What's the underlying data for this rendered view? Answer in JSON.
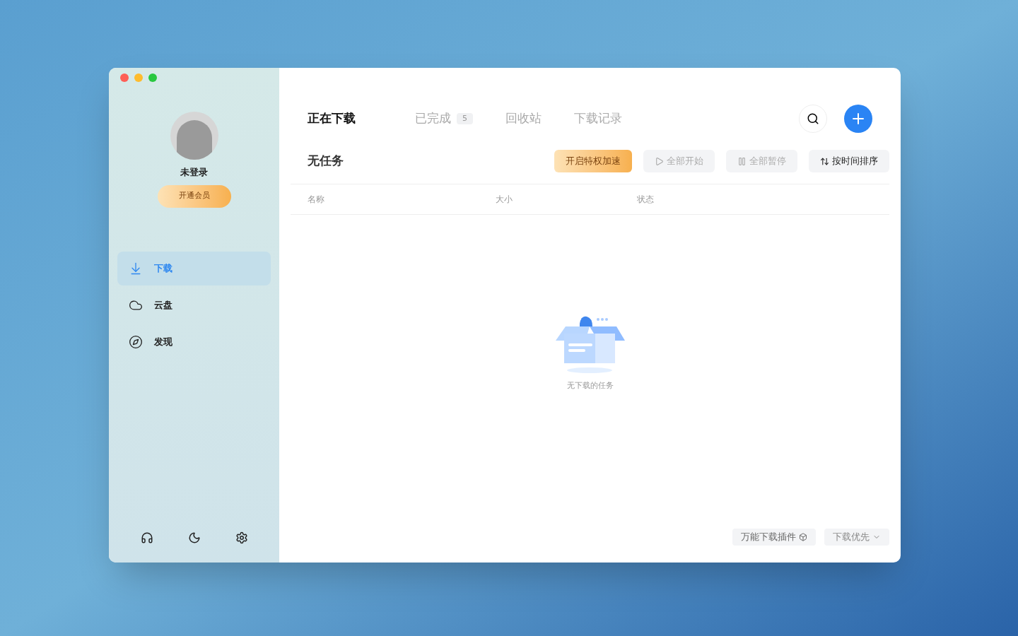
{
  "sidebar": {
    "user": {
      "name": "未登录",
      "vip_button": "开通会员"
    },
    "items": [
      {
        "label": "下载",
        "kind": "download",
        "selected": true
      },
      {
        "label": "云盘",
        "kind": "cloud",
        "selected": false
      },
      {
        "label": "发现",
        "kind": "discover",
        "selected": false
      }
    ]
  },
  "tabs": [
    {
      "label": "正在下载",
      "selected": true
    },
    {
      "label": "已完成",
      "selected": false,
      "count": "5"
    },
    {
      "label": "回收站",
      "selected": false
    },
    {
      "label": "下载记录",
      "selected": false
    }
  ],
  "toolbar": {
    "title": "无任务",
    "buttons": [
      {
        "label": "开启特权加速",
        "kind": "promo",
        "disabled": false
      },
      {
        "label": "全部开始",
        "kind": "play",
        "disabled": true
      },
      {
        "label": "全部暂停",
        "kind": "pause",
        "disabled": true
      },
      {
        "label": "按时间排序",
        "kind": "sort",
        "disabled": false
      }
    ]
  },
  "table": {
    "columns": [
      "名称",
      "大小",
      "状态"
    ]
  },
  "empty_state": {
    "message": "无下载的任务"
  },
  "footer": {
    "plugin_button": "万能下载插件",
    "priority_dropdown": "下载优先"
  }
}
